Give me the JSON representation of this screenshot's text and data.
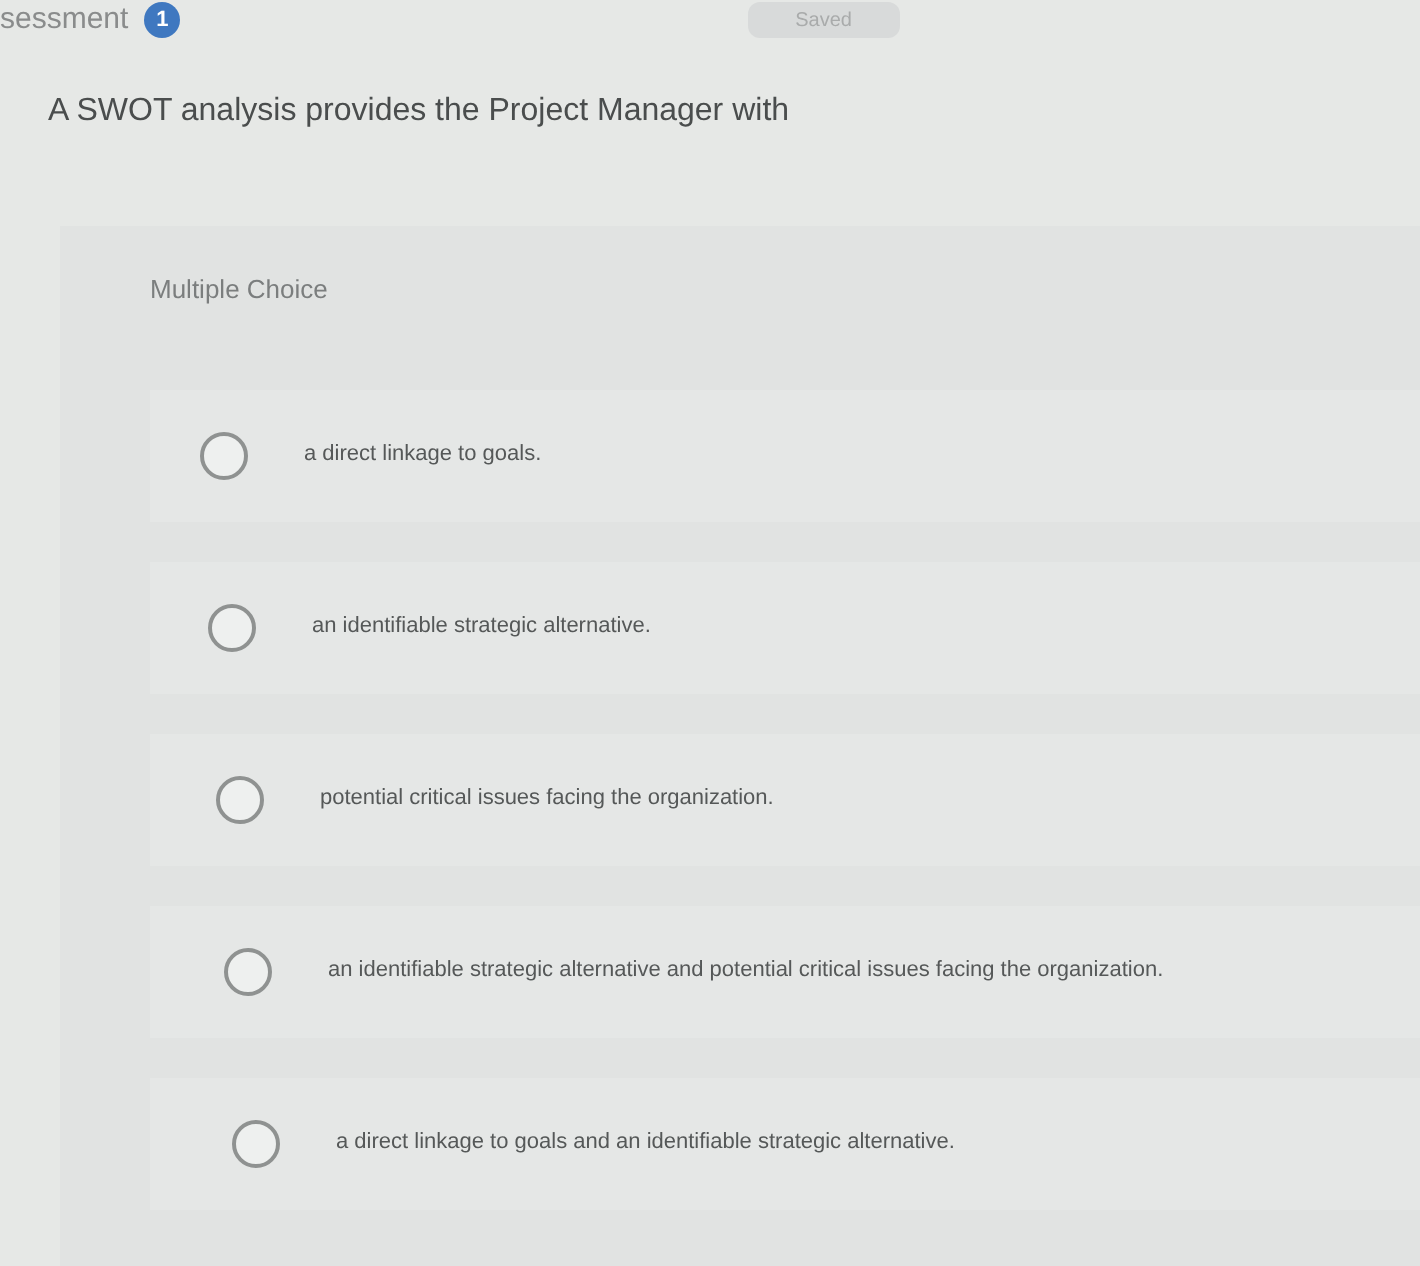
{
  "header": {
    "title": "sessment",
    "badge": "1",
    "save_button": "Saved"
  },
  "question": "A SWOT analysis provides the Project Manager with",
  "question_type": "Multiple Choice",
  "options": [
    {
      "label": "a direct linkage to goals.",
      "selected": false
    },
    {
      "label": "an identifiable strategic alternative.",
      "selected": false
    },
    {
      "label": "potential critical issues facing the organization.",
      "selected": false
    },
    {
      "label": "an identifiable strategic alternative and potential critical issues facing the organization.",
      "selected": false
    },
    {
      "label": "a direct linkage to goals and an identifiable strategic alternative.",
      "selected": false
    }
  ]
}
